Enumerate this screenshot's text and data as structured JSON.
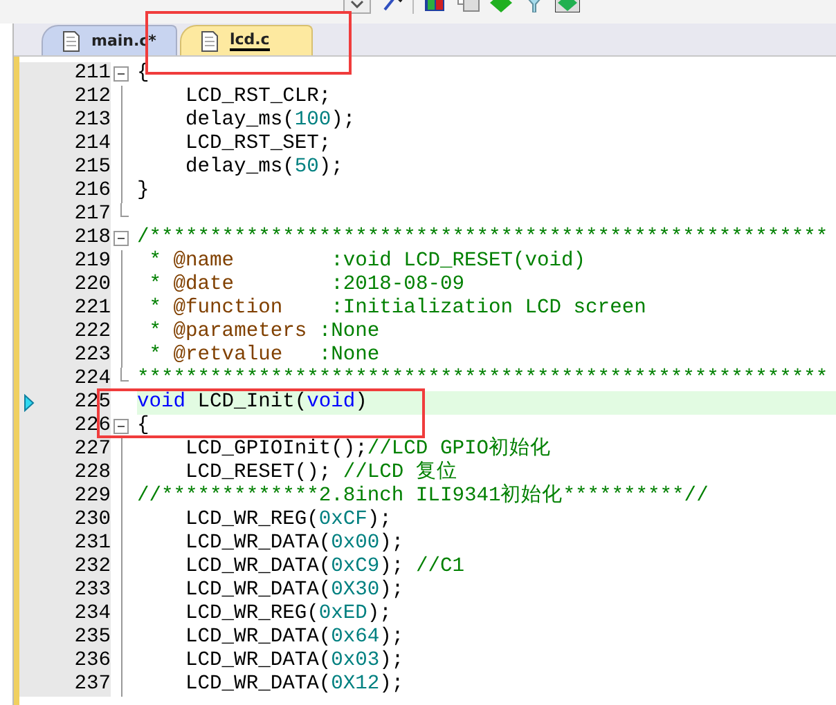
{
  "tabs": [
    {
      "label": "main.c*",
      "selected": false
    },
    {
      "label": "lcd.c",
      "selected": true
    }
  ],
  "lines": [
    {
      "number": "211",
      "kind": "fold_start",
      "current": false,
      "segments": [
        {
          "kind": "plain",
          "text": "{"
        }
      ]
    },
    {
      "number": "212",
      "kind": "fold_body",
      "current": false,
      "segments": [
        {
          "kind": "plain",
          "text": "    LCD_RST_CLR;"
        }
      ]
    },
    {
      "number": "213",
      "kind": "fold_body",
      "current": false,
      "segments": [
        {
          "kind": "plain",
          "text": "    delay_ms("
        },
        {
          "kind": "number",
          "text": "100"
        },
        {
          "kind": "plain",
          "text": ");"
        }
      ]
    },
    {
      "number": "214",
      "kind": "fold_body",
      "current": false,
      "segments": [
        {
          "kind": "plain",
          "text": "    LCD_RST_SET;"
        }
      ]
    },
    {
      "number": "215",
      "kind": "fold_body",
      "current": false,
      "segments": [
        {
          "kind": "plain",
          "text": "    delay_ms("
        },
        {
          "kind": "number",
          "text": "50"
        },
        {
          "kind": "plain",
          "text": ");"
        }
      ]
    },
    {
      "number": "216",
      "kind": "fold_body",
      "current": false,
      "segments": [
        {
          "kind": "plain",
          "text": "}"
        }
      ]
    },
    {
      "number": "217",
      "kind": "fold_end",
      "current": false
    },
    {
      "number": "218",
      "kind": "fold_start",
      "current": false,
      "segments": [
        {
          "kind": "comment",
          "text": "/********************************************************"
        }
      ]
    },
    {
      "number": "219",
      "kind": "fold_body",
      "current": false,
      "segments": [
        {
          "kind": "comment",
          "text": " * "
        },
        {
          "kind": "doctag",
          "text": "@name"
        },
        {
          "kind": "comment",
          "text": "        :void LCD_RESET(void)"
        }
      ]
    },
    {
      "number": "220",
      "kind": "fold_body",
      "current": false,
      "segments": [
        {
          "kind": "comment",
          "text": " * "
        },
        {
          "kind": "doctag",
          "text": "@date"
        },
        {
          "kind": "comment",
          "text": "        :2018-08-09"
        }
      ]
    },
    {
      "number": "221",
      "kind": "fold_body",
      "current": false,
      "segments": [
        {
          "kind": "comment",
          "text": " * "
        },
        {
          "kind": "doctag",
          "text": "@function"
        },
        {
          "kind": "comment",
          "text": "    :Initialization LCD screen"
        }
      ]
    },
    {
      "number": "222",
      "kind": "fold_body",
      "current": false,
      "segments": [
        {
          "kind": "comment",
          "text": " * "
        },
        {
          "kind": "doctag",
          "text": "@parameters"
        },
        {
          "kind": "comment",
          "text": " :None"
        }
      ]
    },
    {
      "number": "223",
      "kind": "fold_body",
      "current": false,
      "segments": [
        {
          "kind": "comment",
          "text": " * "
        },
        {
          "kind": "doctag",
          "text": "@retvalue"
        },
        {
          "kind": "comment",
          "text": "   :None"
        }
      ]
    },
    {
      "number": "224",
      "kind": "fold_end",
      "current": false,
      "segments": [
        {
          "kind": "comment",
          "text": "*********************************************************"
        }
      ]
    },
    {
      "number": "225",
      "kind": "plain",
      "current": true,
      "segments": [
        {
          "kind": "keyword",
          "text": "void"
        },
        {
          "kind": "plain",
          "text": " LCD_Init("
        },
        {
          "kind": "keyword",
          "text": "void"
        },
        {
          "kind": "plain",
          "text": ")"
        }
      ]
    },
    {
      "number": "226",
      "kind": "fold_start",
      "current": false,
      "segments": [
        {
          "kind": "plain",
          "text": "{"
        }
      ]
    },
    {
      "number": "227",
      "kind": "fold_body",
      "current": false,
      "segments": [
        {
          "kind": "plain",
          "text": "    LCD_GPIOInit();"
        },
        {
          "kind": "comment",
          "text": "//LCD GPIO初始化"
        }
      ]
    },
    {
      "number": "228",
      "kind": "fold_body",
      "current": false,
      "segments": [
        {
          "kind": "plain",
          "text": "    LCD_RESET(); "
        },
        {
          "kind": "comment",
          "text": "//LCD 复位"
        }
      ]
    },
    {
      "number": "229",
      "kind": "fold_body",
      "current": false,
      "segments": [
        {
          "kind": "comment",
          "text": "//*************2.8inch ILI9341初始化**********//"
        }
      ]
    },
    {
      "number": "230",
      "kind": "fold_body",
      "current": false,
      "segments": [
        {
          "kind": "plain",
          "text": "    LCD_WR_REG("
        },
        {
          "kind": "number",
          "text": "0xCF"
        },
        {
          "kind": "plain",
          "text": ");"
        }
      ]
    },
    {
      "number": "231",
      "kind": "fold_body",
      "current": false,
      "segments": [
        {
          "kind": "plain",
          "text": "    LCD_WR_DATA("
        },
        {
          "kind": "number",
          "text": "0x00"
        },
        {
          "kind": "plain",
          "text": ");"
        }
      ]
    },
    {
      "number": "232",
      "kind": "fold_body",
      "current": false,
      "segments": [
        {
          "kind": "plain",
          "text": "    LCD_WR_DATA("
        },
        {
          "kind": "number",
          "text": "0xC9"
        },
        {
          "kind": "plain",
          "text": "); "
        },
        {
          "kind": "comment",
          "text": "//C1"
        }
      ]
    },
    {
      "number": "233",
      "kind": "fold_body",
      "current": false,
      "segments": [
        {
          "kind": "plain",
          "text": "    LCD_WR_DATA("
        },
        {
          "kind": "number",
          "text": "0X30"
        },
        {
          "kind": "plain",
          "text": ");"
        }
      ]
    },
    {
      "number": "234",
      "kind": "fold_body",
      "current": false,
      "segments": [
        {
          "kind": "plain",
          "text": "    LCD_WR_REG("
        },
        {
          "kind": "number",
          "text": "0xED"
        },
        {
          "kind": "plain",
          "text": ");"
        }
      ]
    },
    {
      "number": "235",
      "kind": "fold_body",
      "current": false,
      "segments": [
        {
          "kind": "plain",
          "text": "    LCD_WR_DATA("
        },
        {
          "kind": "number",
          "text": "0x64"
        },
        {
          "kind": "plain",
          "text": ");"
        }
      ]
    },
    {
      "number": "236",
      "kind": "fold_body",
      "current": false,
      "segments": [
        {
          "kind": "plain",
          "text": "    LCD_WR_DATA("
        },
        {
          "kind": "number",
          "text": "0x03"
        },
        {
          "kind": "plain",
          "text": ");"
        }
      ]
    },
    {
      "number": "237",
      "kind": "fold_body",
      "current": false,
      "segments": [
        {
          "kind": "plain",
          "text": "    LCD_WR_DATA("
        },
        {
          "kind": "number",
          "text": "0X12"
        },
        {
          "kind": "plain",
          "text": ");"
        }
      ]
    }
  ]
}
